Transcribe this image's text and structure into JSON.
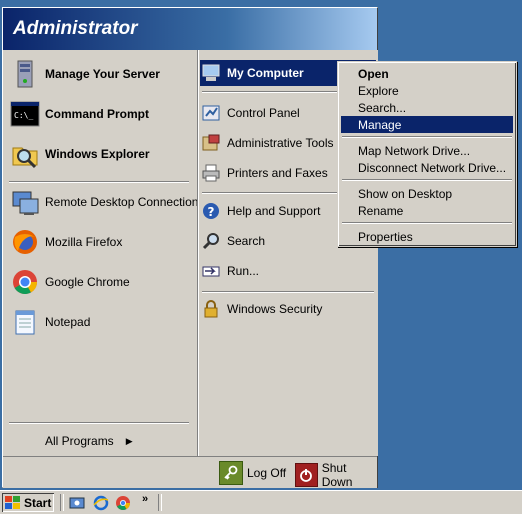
{
  "user": {
    "name": "Administrator"
  },
  "left_pinned": [
    {
      "label": "Manage Your Server",
      "icon": "manage-server-icon"
    },
    {
      "label": "Command Prompt",
      "icon": "command-prompt-icon"
    },
    {
      "label": "Windows Explorer",
      "icon": "windows-explorer-icon"
    }
  ],
  "left_recent": [
    {
      "label": "Remote Desktop Connection",
      "icon": "remote-desktop-icon"
    },
    {
      "label": "Mozilla Firefox",
      "icon": "firefox-icon"
    },
    {
      "label": "Google Chrome",
      "icon": "chrome-icon"
    },
    {
      "label": "Notepad",
      "icon": "notepad-icon"
    }
  ],
  "all_programs": {
    "label": "All Programs"
  },
  "right_items": [
    {
      "label": "My Computer",
      "icon": "my-computer-icon",
      "selected": true
    },
    {
      "label": "Control Panel",
      "icon": "control-panel-icon"
    },
    {
      "label": "Administrative Tools",
      "icon": "administrative-tools-icon"
    },
    {
      "label": "Printers and Faxes",
      "icon": "printers-icon"
    },
    {
      "label": "Help and Support",
      "icon": "help-icon"
    },
    {
      "label": "Search",
      "icon": "search-icon"
    },
    {
      "label": "Run...",
      "icon": "run-icon"
    },
    {
      "label": "Windows Security",
      "icon": "windows-security-icon"
    }
  ],
  "bottom": {
    "logoff": "Log Off",
    "shutdown": "Shut Down"
  },
  "context_menu": [
    {
      "label": "Open",
      "bold": true
    },
    {
      "label": "Explore"
    },
    {
      "label": "Search..."
    },
    {
      "label": "Manage",
      "selected": true
    },
    {
      "label": "Map Network Drive..."
    },
    {
      "label": "Disconnect Network Drive..."
    },
    {
      "label": "Show on Desktop"
    },
    {
      "label": "Rename"
    },
    {
      "label": "Properties"
    }
  ],
  "taskbar": {
    "start_label": "Start",
    "chevron": "»"
  }
}
